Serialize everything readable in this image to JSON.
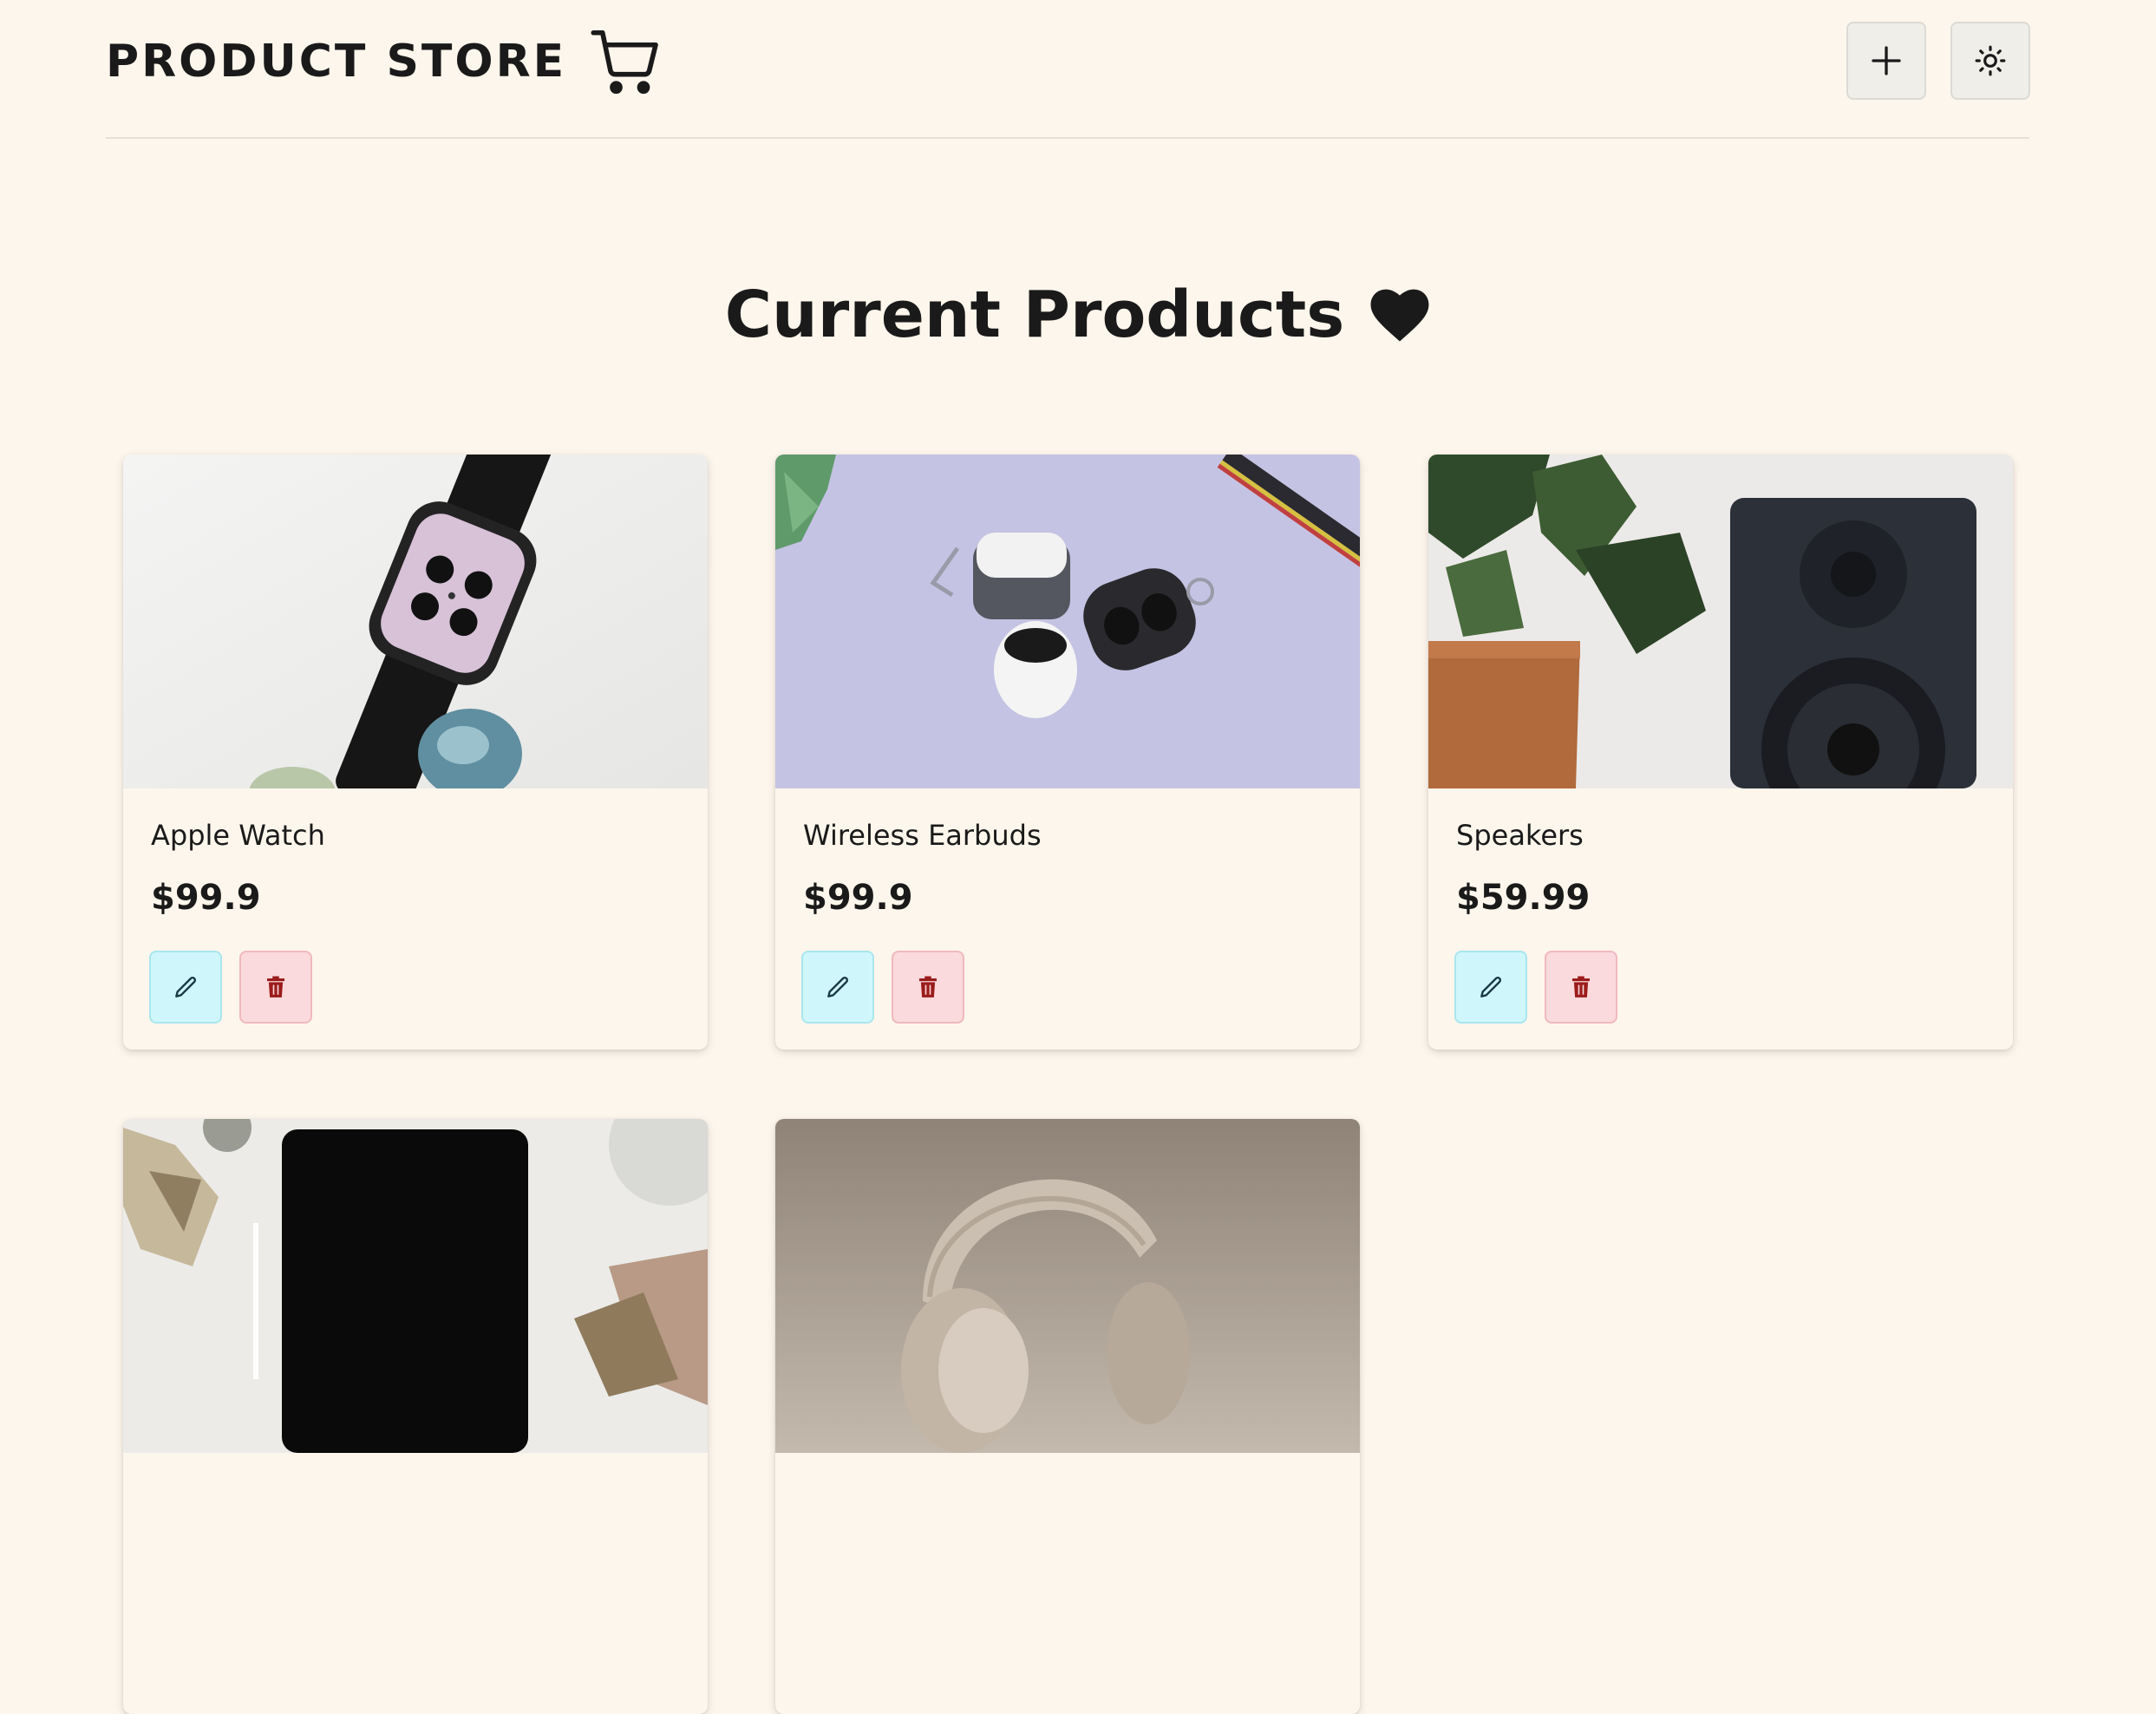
{
  "navbar": {
    "brand": "PRODUCT STORE",
    "brand_icon": "shopping-cart-icon",
    "create_button_icon": "plus-icon",
    "theme_button_icon": "sun-icon"
  },
  "main": {
    "heading": "Current Products",
    "heading_icon": "heart-icon"
  },
  "products": [
    {
      "name": "Apple Watch",
      "price": "$99.9"
    },
    {
      "name": "Wireless Earbuds",
      "price": "$99.9"
    },
    {
      "name": "Speakers",
      "price": "$59.99"
    },
    {
      "name": "",
      "price": ""
    },
    {
      "name": "",
      "price": ""
    }
  ],
  "colors": {
    "background": "#fdf6ec",
    "edit_button_bg": "#cff7fb",
    "delete_button_bg": "#fadadc",
    "delete_icon": "#9b1c1c"
  }
}
